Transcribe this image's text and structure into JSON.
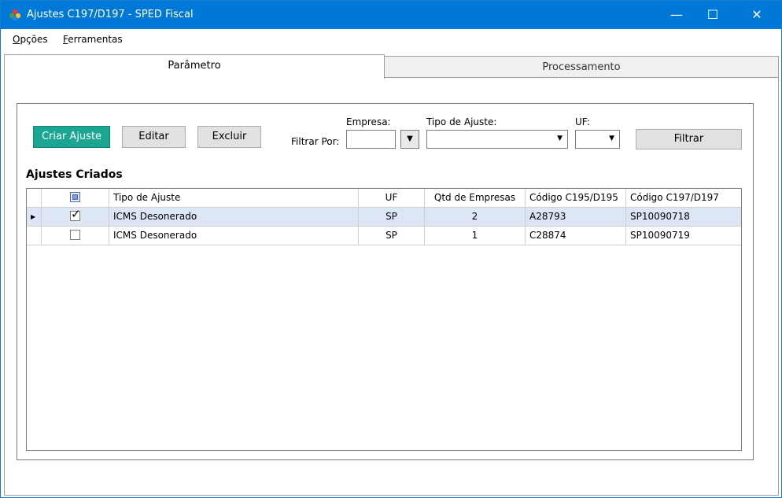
{
  "window": {
    "title": "Ajustes C197/D197 - SPED Fiscal",
    "minimize": "—",
    "maximize": "☐",
    "close": "✕",
    "accent": "#0078d7"
  },
  "menu": {
    "items": [
      {
        "underlined": "O",
        "rest": "pções"
      },
      {
        "underlined": "F",
        "rest": "erramentas"
      }
    ]
  },
  "tabs": [
    {
      "label": "Parâmetro",
      "active": true
    },
    {
      "label": "Processamento",
      "active": false
    }
  ],
  "toolbar": {
    "create_label": "Criar Ajuste",
    "edit_label": "Editar",
    "delete_label": "Excluir",
    "create_color": "#1aa691"
  },
  "filters": {
    "filter_by_label": "Filtrar Por:",
    "empresa_label": "Empresa:",
    "empresa_value": "",
    "empresa_button": "▼",
    "tipo_label": "Tipo de Ajuste:",
    "tipo_value": "",
    "uf_label": "UF:",
    "uf_value": "",
    "filter_button": "Filtrar"
  },
  "section_title": "Ajustes Criados",
  "table": {
    "columns": [
      "Tipo de Ajuste",
      "UF",
      "Qtd de Empresas",
      "Código C195/D195",
      "Código C197/D197"
    ],
    "rows": [
      {
        "checked": true,
        "tipo": "ICMS Desonerado",
        "uf": "SP",
        "qtd": "2",
        "c195": "A28793",
        "c197": "SP10090718",
        "selected": true
      },
      {
        "checked": false,
        "tipo": "ICMS Desonerado",
        "uf": "SP",
        "qtd": "1",
        "c195": "C28874",
        "c197": "SP10090719",
        "selected": false
      }
    ]
  }
}
